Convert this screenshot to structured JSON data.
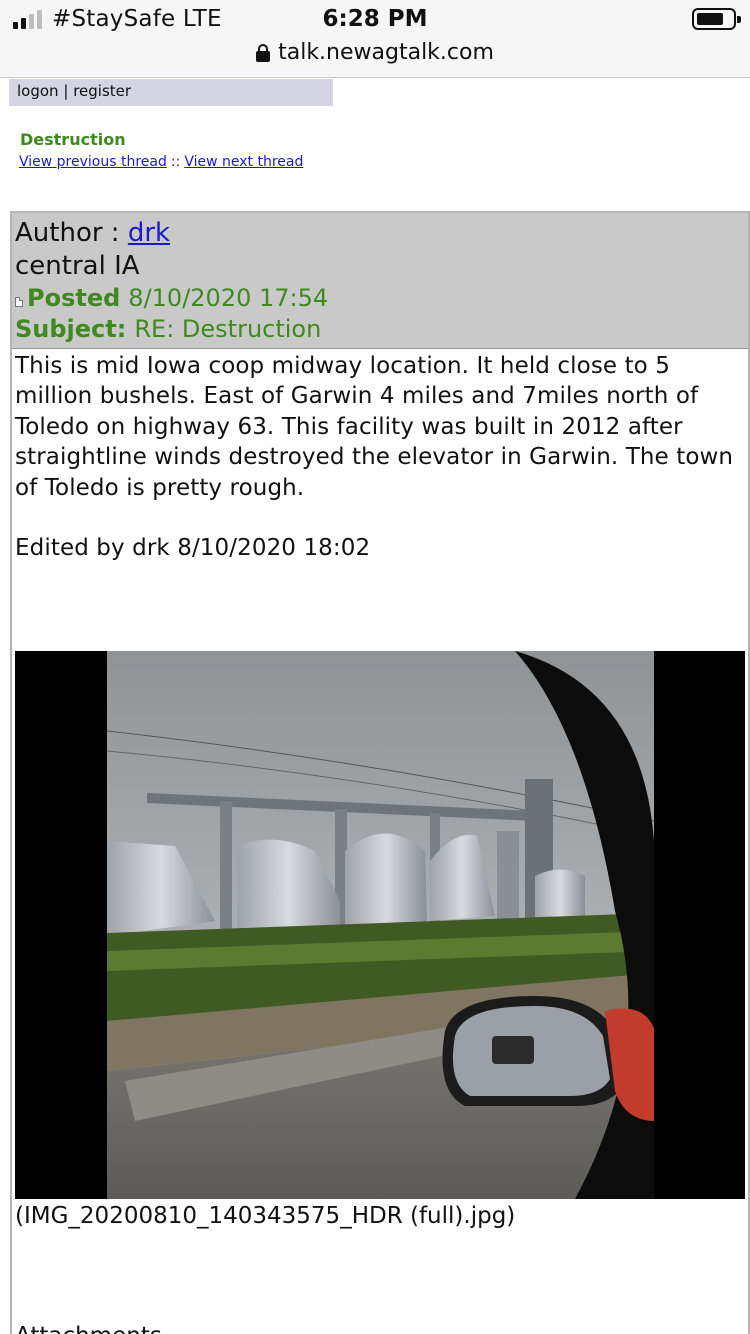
{
  "status_bar": {
    "carrier": "#StaySafe  LTE",
    "time": "6:28 PM",
    "url": "talk.newagtalk.com",
    "icons": [
      "signal-icon",
      "battery-icon",
      "lock-icon"
    ]
  },
  "nav": {
    "logon": "logon",
    "separator": "|",
    "register": "register"
  },
  "thread": {
    "title": "Destruction",
    "prev_link": "View previous thread",
    "nav_sep": "::",
    "next_link": "View next thread"
  },
  "post": {
    "author_label": "Author :",
    "author_name": "drk",
    "location": "central IA",
    "posted_label": "Posted",
    "posted_date": "8/10/2020 17:54",
    "subject_label": "Subject:",
    "subject": "RE: Destruction",
    "body": "This is mid Iowa coop midway location. It held close to 5 million bushels. East of Garwin 4 miles and 7miles north of Toledo on highway 63. This facility was built in 2012 after straightline winds destroyed the elevator in Garwin. The town of Toledo is pretty rough.",
    "edited": "Edited by drk 8/10/2020 18:02",
    "image_caption": "(IMG_20200810_140343575_HDR (full).jpg)",
    "attachments_label": "Attachments"
  },
  "colors": {
    "accent_green": "#3f8a1f",
    "link_blue": "#1a1acc",
    "header_gray": "#c9c9c9",
    "logon_bg": "#d4d4e4"
  }
}
